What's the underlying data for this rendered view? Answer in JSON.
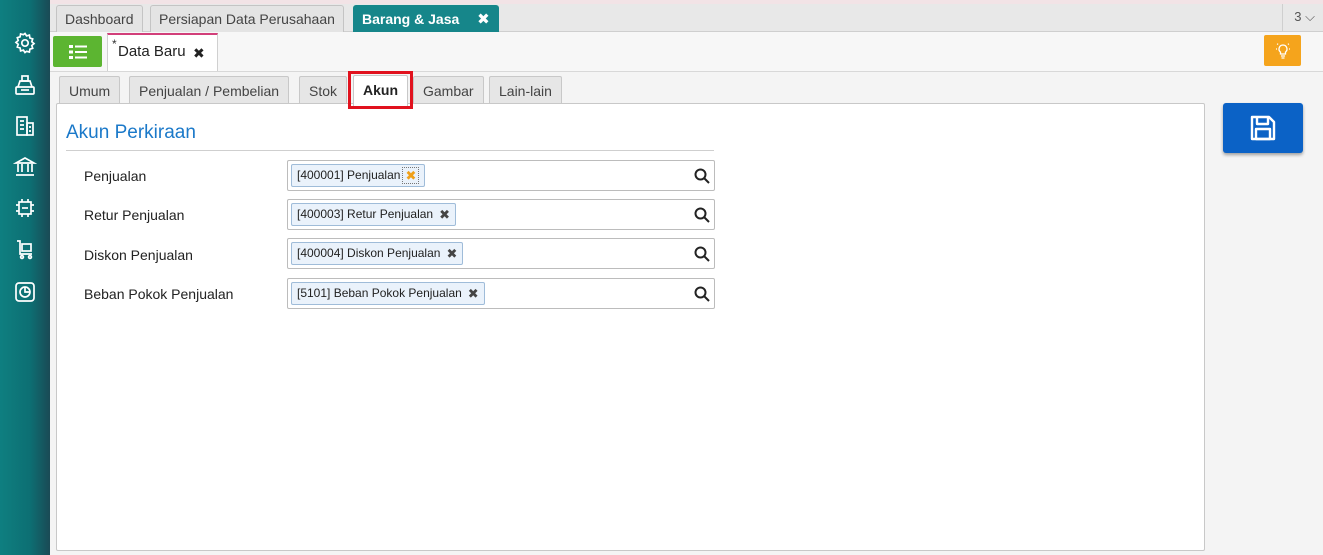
{
  "sidebar": {
    "icons": [
      "gear-icon",
      "cash-register-icon",
      "building-icon",
      "bank-icon",
      "transfer-icon",
      "cart-icon",
      "report-chart-icon"
    ]
  },
  "top_tabs": [
    {
      "label": "Dashboard",
      "active": false
    },
    {
      "label": "Persiapan Data Perusahaan",
      "active": false
    },
    {
      "label": "Barang & Jasa",
      "active": true,
      "close": "✖"
    }
  ],
  "tab_count": "3 ⌵",
  "document_tab": {
    "modified_marker": "*",
    "label": "Data Baru",
    "close": "✖"
  },
  "sub_tabs": [
    {
      "label": "Umum",
      "active": false
    },
    {
      "label": "Penjualan / Pembelian",
      "active": false
    },
    {
      "label": "Stok",
      "active": false
    },
    {
      "label": "Akun",
      "active": true
    },
    {
      "label": "Gambar",
      "active": false
    },
    {
      "label": "Lain-lain",
      "active": false
    }
  ],
  "section": {
    "title": "Akun Perkiraan",
    "rows": [
      {
        "label": "Penjualan",
        "value": "[400001] Penjualan",
        "remove": "✖"
      },
      {
        "label": "Retur Penjualan",
        "value": "[400003] Retur Penjualan",
        "remove": "✖"
      },
      {
        "label": "Diskon Penjualan",
        "value": "[400004] Diskon Penjualan",
        "remove": "✖"
      },
      {
        "label": "Beban Pokok Penjualan",
        "value": "[5101] Beban Pokok Penjualan",
        "remove": "✖"
      }
    ]
  },
  "colors": {
    "sidebar": "#0e7f80",
    "active_tab": "#16868a",
    "menu_button": "#5cb531",
    "bulb_button": "#f5a41c",
    "save_button": "#0b62c6",
    "section_title": "#1b79c9",
    "highlight": "#e1121e"
  }
}
